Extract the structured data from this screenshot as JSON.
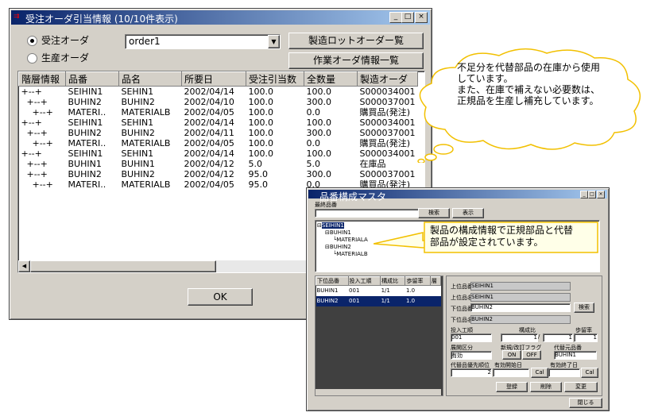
{
  "main_window": {
    "title": "受注オーダ引当情報 (10/10件表示)",
    "radio_order": "受注オーダ",
    "radio_production": "生産オーダ",
    "order_value": "order1",
    "btn_lot": "製造ロットオーダー覧",
    "btn_work": "作業オーダ情報一覧",
    "ok": "OK",
    "columns": [
      "階層情報",
      "品番",
      "品名",
      "所要日",
      "受注引当数",
      "全数量",
      "製造オーダ"
    ],
    "rows": [
      [
        "+--+",
        "SEIHIN1",
        "SEHIN1",
        "2002/04/14",
        "100.0",
        "100.0",
        "S000034001"
      ],
      [
        "  +--+",
        "BUHIN2",
        "BUHIN2",
        "2002/04/10",
        "100.0",
        "300.0",
        "S000037001"
      ],
      [
        "    +--+",
        "MATERI..",
        "MATERIALB",
        "2002/04/05",
        "100.0",
        "0.0",
        "購買品(発注)"
      ],
      [
        "+--+",
        "SEIHIN1",
        "SEHIN1",
        "2002/04/14",
        "100.0",
        "100.0",
        "S000034001"
      ],
      [
        "  +--+",
        "BUHIN2",
        "BUHIN2",
        "2002/04/11",
        "100.0",
        "300.0",
        "S000037001"
      ],
      [
        "    +--+",
        "MATERI..",
        "MATERIALB",
        "2002/04/05",
        "100.0",
        "0.0",
        "購買品(発注)"
      ],
      [
        "+--+",
        "SEIHIN1",
        "SEHIN1",
        "2002/04/14",
        "100.0",
        "100.0",
        "S000034001"
      ],
      [
        "  +--+",
        "BUHIN1",
        "BUHIN1",
        "2002/04/12",
        "5.0",
        "5.0",
        "在庫品"
      ],
      [
        "  +--+",
        "BUHIN2",
        "BUHIN2",
        "2002/04/12",
        "95.0",
        "300.0",
        "S000037001"
      ],
      [
        "    +--+",
        "MATERI..",
        "MATERIALB",
        "2002/04/05",
        "95.0",
        "0.0",
        "購買品(発注)"
      ]
    ]
  },
  "callout_top": {
    "lines": [
      "不足分を代替部品の在庫から使用",
      "しています。",
      "また、在庫で補えない必要数は、",
      "正規品を生産し補充しています。"
    ]
  },
  "callout_tree": {
    "lines": [
      "製品の構成情報で正規部品と代替",
      "部品が設定されています。"
    ]
  },
  "bom_window": {
    "title": "品番構成マスタ",
    "top_label": "最終品番",
    "search_btn": "検索",
    "show_btn": "表示",
    "tree": [
      {
        "text": "SEIHIN1",
        "indent": 0,
        "prefix": "⊟"
      },
      {
        "text": "BUHIN1",
        "indent": 1,
        "prefix": "⊟"
      },
      {
        "text": "MATERIALA",
        "indent": 2,
        "prefix": "└"
      },
      {
        "text": "BUHIN2",
        "indent": 1,
        "prefix": "⊟"
      },
      {
        "text": "MATERIALB",
        "indent": 2,
        "prefix": "└"
      }
    ],
    "list_columns": [
      "下位品番",
      "投入工順",
      "構成比",
      "歩留率",
      "層"
    ],
    "list_rows": [
      [
        "BUHIN1",
        "001",
        "1/1",
        "1.0"
      ],
      [
        "BUHIN2",
        "001",
        "1/1",
        "1.0"
      ]
    ],
    "form": {
      "upper_code_label": "上位品番",
      "upper_code": "SEIHIN1",
      "upper_name_label": "上位品名",
      "upper_name": "SEIHIN1",
      "lower_code_label": "下位品番",
      "lower_code": "BUHIN2",
      "lower_search": "検索",
      "lower_name_label": "下位品名",
      "lower_name": "BUHIN2",
      "process_label": "投入工順",
      "process_value": "001",
      "ratio_label": "構成比",
      "ratio_num": "1",
      "ratio_den": "1",
      "yield_label": "歩留率",
      "yield_value": "1",
      "expand_label": "展開区分",
      "expand_value": "有効",
      "flag_label": "新規/改訂フラグ",
      "flag_on": "ON",
      "flag_off": "OFF",
      "alt_label": "代替元品番",
      "alt_value": "BUHIN1",
      "priority_label": "代替品優先順位",
      "priority_value": "2",
      "start_label": "有効開始日",
      "end_label": "有効終了日",
      "cal1": "Cal",
      "cal2": "Cal",
      "register": "登録",
      "delete": "削除",
      "change": "変更",
      "close": "閉じる"
    }
  }
}
